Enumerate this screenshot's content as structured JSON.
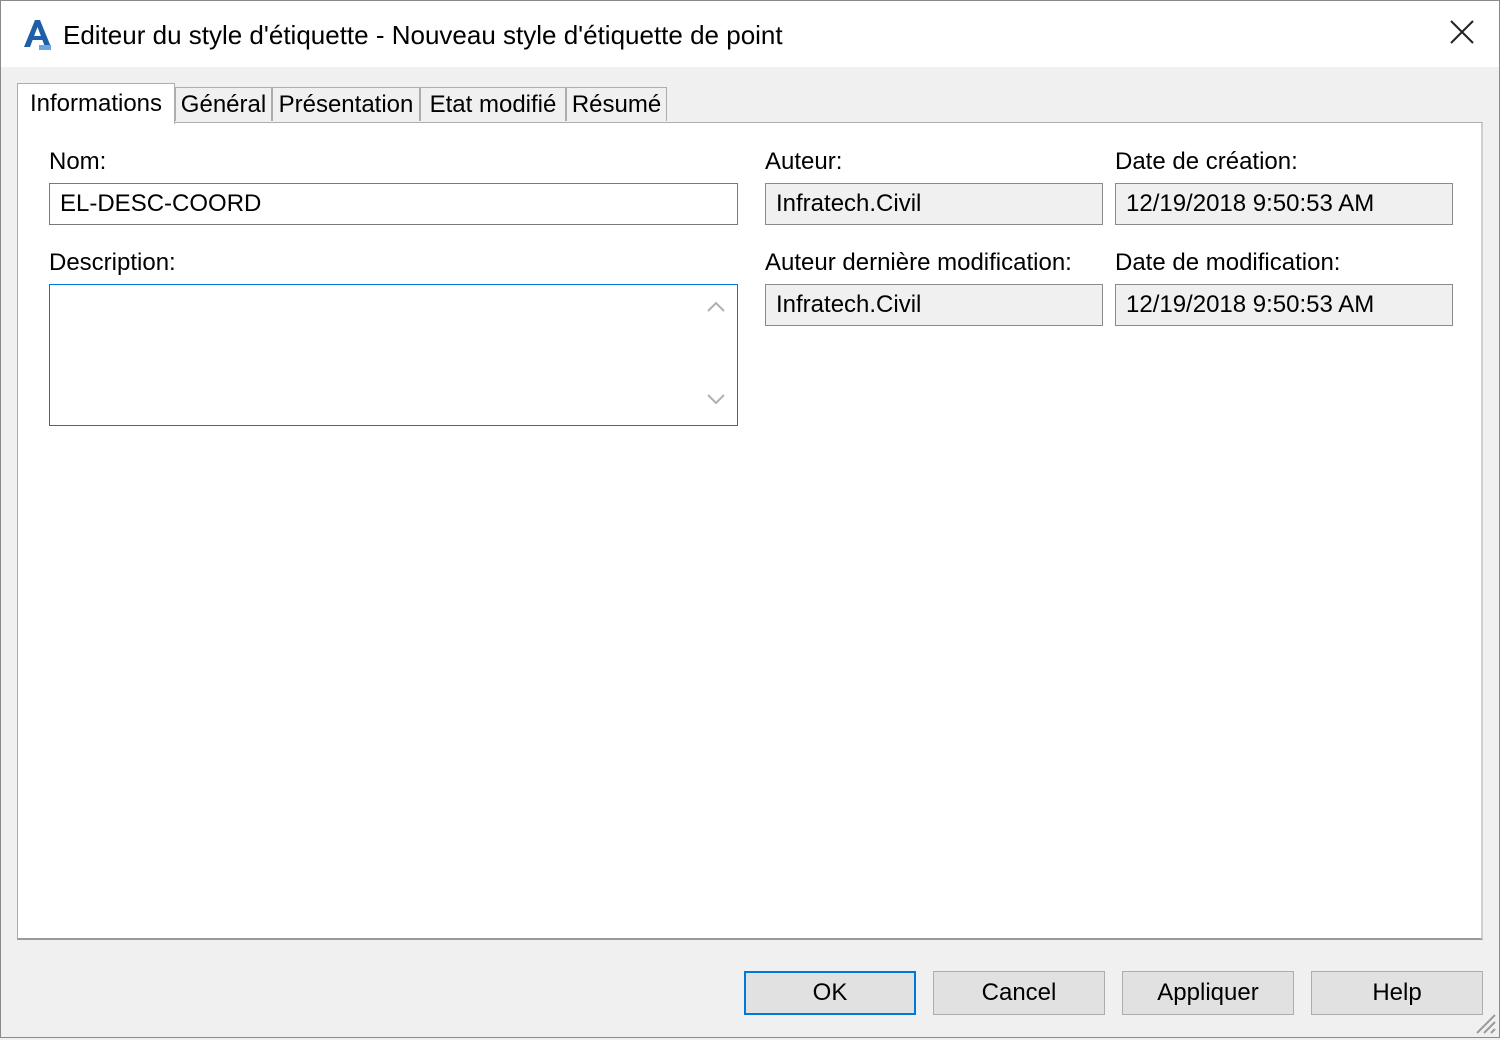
{
  "window": {
    "title": "Editeur du style d'étiquette - Nouveau style d'étiquette de point",
    "app_icon": "autodesk-civil-icon",
    "close_icon": "close-icon"
  },
  "tabs": [
    {
      "label": "Informations",
      "active": true
    },
    {
      "label": "Général",
      "active": false
    },
    {
      "label": "Présentation",
      "active": false
    },
    {
      "label": "Etat modifié",
      "active": false
    },
    {
      "label": "Résumé",
      "active": false
    }
  ],
  "info": {
    "name_label": "Nom:",
    "name_value": "EL-DESC-COORD",
    "description_label": "Description:",
    "description_value": "",
    "author_label": "Auteur:",
    "author_value": "Infratech.Civil",
    "created_label": "Date de création:",
    "created_value": "12/19/2018 9:50:53 AM",
    "last_author_label": "Auteur dernière modification:",
    "last_author_value": "Infratech.Civil",
    "modified_label": "Date de modification:",
    "modified_value": "12/19/2018 9:50:53 AM"
  },
  "buttons": {
    "ok": "OK",
    "cancel": "Cancel",
    "apply": "Appliquer",
    "help": "Help"
  },
  "colors": {
    "accent": "#0078d7",
    "app_icon_blue": "#1f5fa8"
  }
}
